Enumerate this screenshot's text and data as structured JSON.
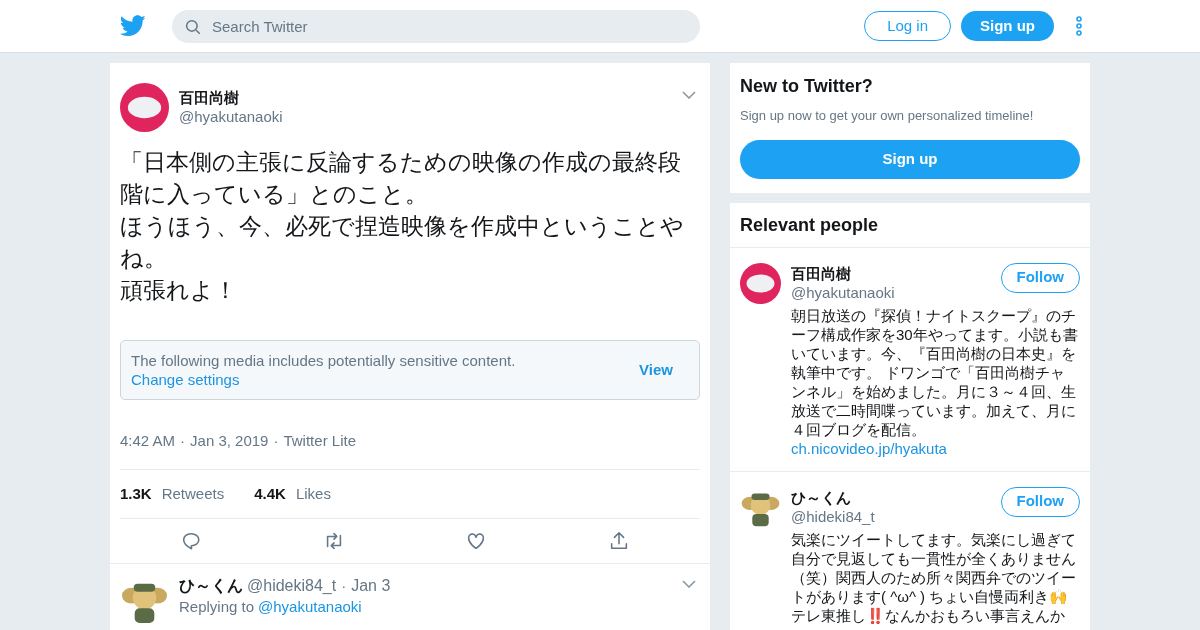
{
  "header": {
    "search": {
      "placeholder": "Search Twitter"
    },
    "buttons": [
      {
        "label": "Log in",
        "kind": "outline"
      },
      {
        "label": "Sign up",
        "kind": "solid"
      }
    ]
  },
  "tweet": {
    "name": "百田尚樹",
    "handle": "@hyakutanaoki",
    "lines": [
      "「日本側の主張に反論するための映像の作成の最終段階に入っている」とのこと。",
      "ほうほう、今、必死で捏造映像を作成中ということやね。",
      "頑張れよ！"
    ],
    "notice": {
      "text": "The following media includes potentially sensitive content.",
      "link": "Change settings",
      "action": "View"
    },
    "meta": [
      "4:42 AM",
      "·",
      "Jan 3, 2019",
      "·",
      "Twitter Lite"
    ],
    "stats": [
      {
        "count": "1.3K",
        "label": "Retweets"
      },
      {
        "count": "4.4K",
        "label": "Likes"
      }
    ]
  },
  "reply": {
    "name": "ひ～くん",
    "handle": "@hideki84_t",
    "separator": "·",
    "date": "Jan 3",
    "replying_label": "Replying to",
    "replying_to": "@hyakutanaoki"
  },
  "signup_card": {
    "title": "New to Twitter?",
    "subtitle": "Sign up now to get your own personalized timeline!",
    "button": "Sign up"
  },
  "relevant": {
    "title": "Relevant people",
    "people": [
      {
        "name": "百田尚樹",
        "handle": "@hyakutanaoki",
        "button": "Follow",
        "bio": "朝日放送の『探偵！ナイトスクープ』のチーフ構成作家を30年やってます。小説も書いています。今、『百田尚樹の日本史』を執筆中です。 ドワンゴで「百田尚樹チャンネル」を始めました。月に３～４回、生放送で二時間喋っています。加えて、月に４回ブログを配信。",
        "link": "ch.nicovideo.jp/hyakuta"
      },
      {
        "name": "ひ～くん",
        "handle": "@hideki84_t",
        "button": "Follow",
        "bio": "気楽にツイートしてます。気楽にし過ぎて自分で見返しても一貫性が全くありません（笑）関西人のため所々関西弁でのツイートがあります( ^ω^ ) ちょい自慢両利き🙌テレ東推し‼️なんかおもろい事言えんか"
      }
    ]
  }
}
